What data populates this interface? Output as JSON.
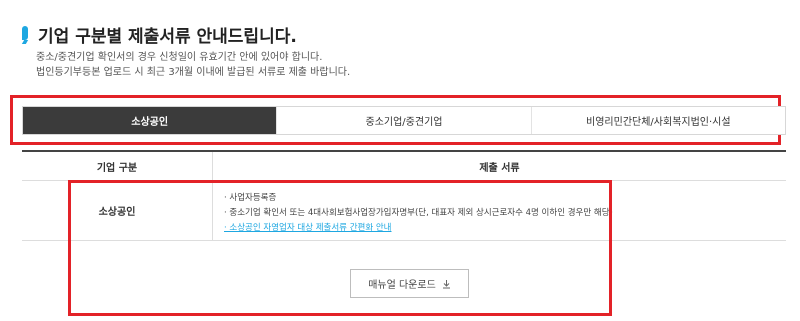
{
  "header": {
    "title": "기업 구분별 제출서류 안내드립니다.",
    "desc_line1": "중소/중견기업 확인서의 경우 신청일이 유효기간 안에 있어야 합니다.",
    "desc_line2": "법인등기부등본 업로드 시 최근 3개월 이내에 발급된 서류로 제출 바랍니다."
  },
  "tabs": [
    "소상공인",
    "중소기업/중견기업",
    "비영리민간단체/사회복지법인·시설"
  ],
  "active_tab": 0,
  "table": {
    "col1_header": "기업 구분",
    "col2_header": "제출 서류",
    "row": {
      "type": "소상공인",
      "doc1": "· 사업자등록증",
      "doc2": "· 중소기업 확인서 또는 4대사회보험사업장가입자명부(단, 대표자 제외 상시근로자수 4명 이하인 경우만 해당)",
      "link": "· 소상공인 자영업자 대상 제출서류 간편화 안내"
    }
  },
  "download_button": "매뉴얼 다운로드",
  "colors": {
    "accent": "#1ea7e1",
    "active_tab_bg": "#3b3b3b",
    "highlight": "#e32228"
  }
}
